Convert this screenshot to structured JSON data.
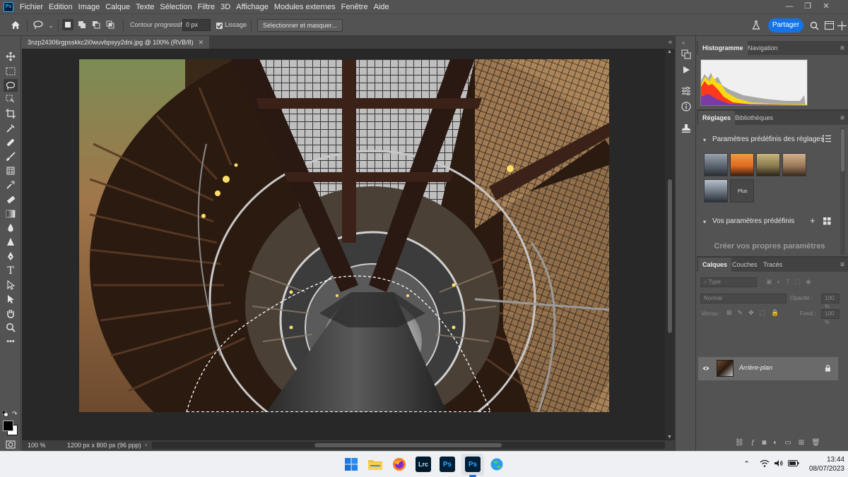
{
  "app": {
    "logo_text": "Ps",
    "menu": [
      "Fichier",
      "Edition",
      "Image",
      "Calque",
      "Texte",
      "Sélection",
      "Filtre",
      "3D",
      "Affichage",
      "Modules externes",
      "Fenêtre",
      "Aide"
    ]
  },
  "options_bar": {
    "contour_label": "Contour progressif :",
    "contour_value": "0 px",
    "lissage_label": "Lissage",
    "select_mask_button": "Sélectionner et masquer...",
    "share_button": "Partager"
  },
  "document": {
    "tab_title": "3nzp24306rgpsskkc2i0wuvbpsyy2dni.jpg @ 100% (RVB/8)",
    "zoom": "100 %",
    "info": "1200 px x 800 px (96 ppp)"
  },
  "panels": {
    "top_tabs": [
      "Histogramme",
      "Navigation"
    ],
    "adjust_tabs": [
      "Réglages",
      "Bibliothèques"
    ],
    "adjust_presets_title": "Paramètres prédéfinis des réglages",
    "more_label": "Plus",
    "your_presets_title": "Vos paramètres prédéfinis",
    "create_presets_text": "Créer vos propres paramètres",
    "layers_tabs": [
      "Calques",
      "Couches",
      "Tracés"
    ],
    "layer_filter_placeholder": "Type",
    "blend_mode": "Normal",
    "opacity_label": "Opacité :",
    "opacity_value": "100 %",
    "lock_label": "Verrou :",
    "fill_label": "Fond :",
    "fill_value": "100 %",
    "layer_name": "Arrière-plan"
  },
  "taskbar": {
    "time": "13:44",
    "date": "08/07/2023",
    "apps": [
      "Lrc",
      "Ps",
      "Ps"
    ]
  },
  "colors": {
    "accent": "#1473e6",
    "ui_dark": "#535353",
    "canvas_bg": "#282828"
  }
}
